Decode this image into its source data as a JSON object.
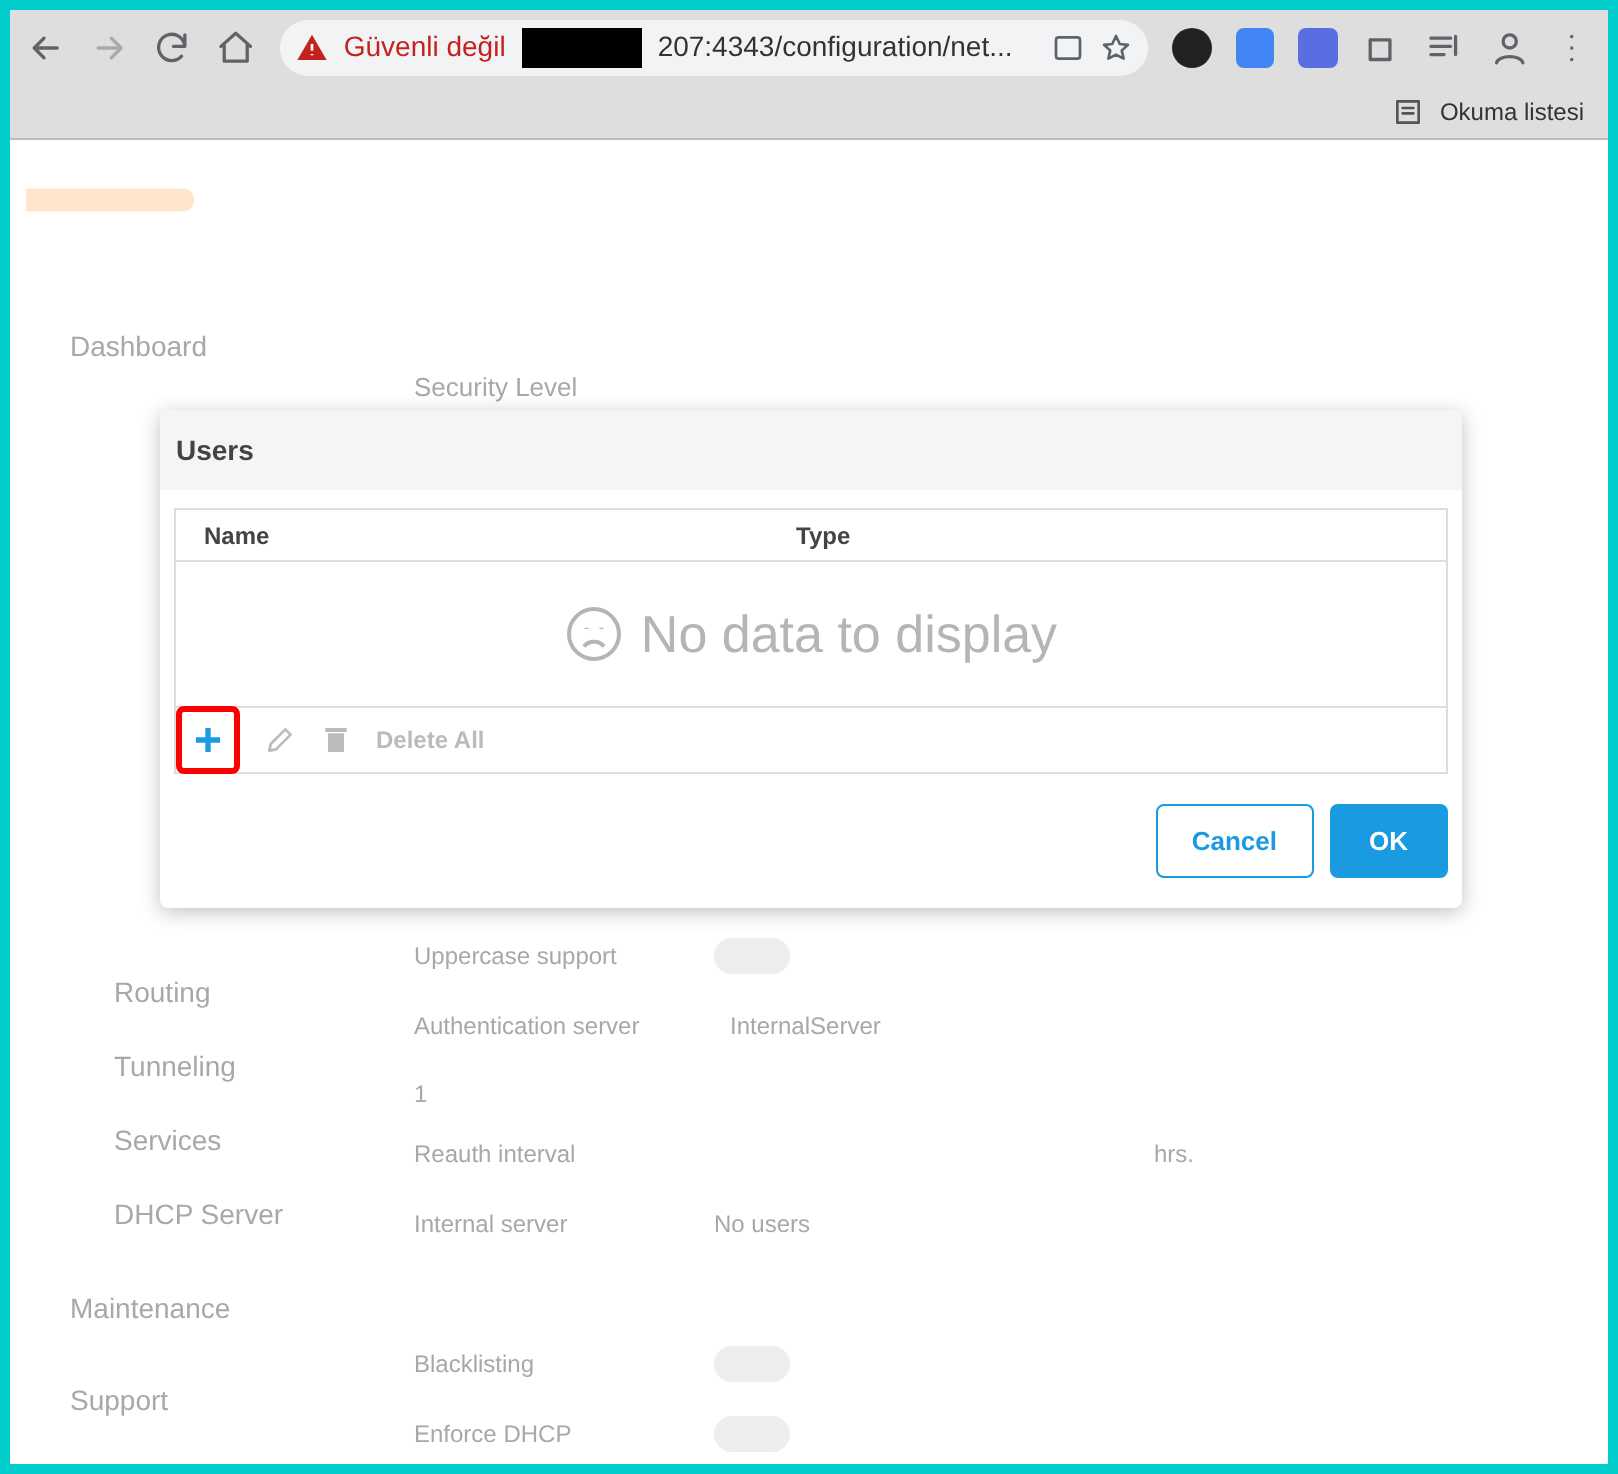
{
  "browser": {
    "security_label": "Güvenli değil",
    "url": "207:4343/configuration/net...",
    "reading_list": "Okuma listesi"
  },
  "background": {
    "sidebar": [
      {
        "label": "Dashboard",
        "kind": "top"
      },
      {
        "label": "Routing",
        "kind": "sub"
      },
      {
        "label": "Tunneling",
        "kind": "sub"
      },
      {
        "label": "Services",
        "kind": "sub"
      },
      {
        "label": "DHCP Server",
        "kind": "sub"
      },
      {
        "label": "Maintenance",
        "kind": "top"
      },
      {
        "label": "Support",
        "kind": "top"
      }
    ],
    "section_title": "Security Level",
    "fields": [
      {
        "label": "Uppercase support",
        "kind": "toggle",
        "on": false
      },
      {
        "label": "Authentication server",
        "kind": "select",
        "value": "InternalServer",
        "note": "1"
      },
      {
        "label": "Reauth interval",
        "kind": "select",
        "value": "hrs."
      },
      {
        "label": "Internal server",
        "kind": "text",
        "value": "No users"
      },
      {
        "label": "Blacklisting",
        "kind": "toggle",
        "on": false
      },
      {
        "label": "Enforce DHCP",
        "kind": "toggle",
        "on": false
      }
    ]
  },
  "dialog": {
    "title": "Users",
    "columns": [
      "Name",
      "Type"
    ],
    "empty_text": "No data to display",
    "delete_all": "Delete All",
    "buttons": [
      {
        "label": "Cancel",
        "kind": "secondary"
      },
      {
        "label": "OK",
        "kind": "primary"
      }
    ]
  }
}
